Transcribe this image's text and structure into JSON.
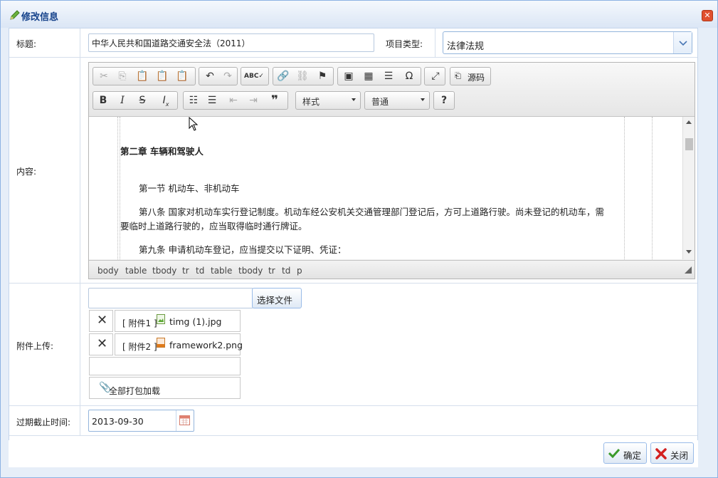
{
  "window": {
    "title": "修改信息"
  },
  "form": {
    "title_label": "标题:",
    "title_value": "中华人民共和国道路交通安全法（2011）",
    "type_label": "项目类型:",
    "type_value": "法律法规",
    "content_label": "内容:",
    "attach_label": "附件上传:",
    "expire_label": "过期截止时间:",
    "expire_value": "2013-09-30"
  },
  "editor": {
    "source_label": "源码",
    "style_label": "样式",
    "format_label": "普通",
    "help_label": "?",
    "paragraphs": [
      {
        "text": "第二章 车辆和驾驶人",
        "bold": true
      },
      {
        "text": "第一节 机动车、非机动车",
        "bold": false
      },
      {
        "text": "第八条 国家对机动车实行登记制度。机动车经公安机关交通管理部门登记后，方可上道路行驶。尚未登记的机动车，需",
        "bold": false
      },
      {
        "text": "要临时上道路行驶的，应当取得临时通行牌证。",
        "bold": false
      },
      {
        "text": "第九条 申请机动车登记，应当提交以下证明、凭证：",
        "bold": false
      }
    ],
    "path": [
      "body",
      "table",
      "tbody",
      "tr",
      "td",
      "table",
      "tbody",
      "tr",
      "td",
      "p"
    ]
  },
  "attachments": {
    "choose_button": "选择文件",
    "files": [
      {
        "label": "[ 附件1 ]",
        "name": "timg (1).jpg"
      },
      {
        "label": "[ 附件2 ]",
        "name": "framework2.png"
      }
    ],
    "download_all": "全部打包加载"
  },
  "footer": {
    "ok_label": "确定",
    "close_label": "关闭"
  },
  "colors": {
    "accent": "#15428b",
    "ok": "#3a9a2a",
    "close": "#d32020"
  }
}
